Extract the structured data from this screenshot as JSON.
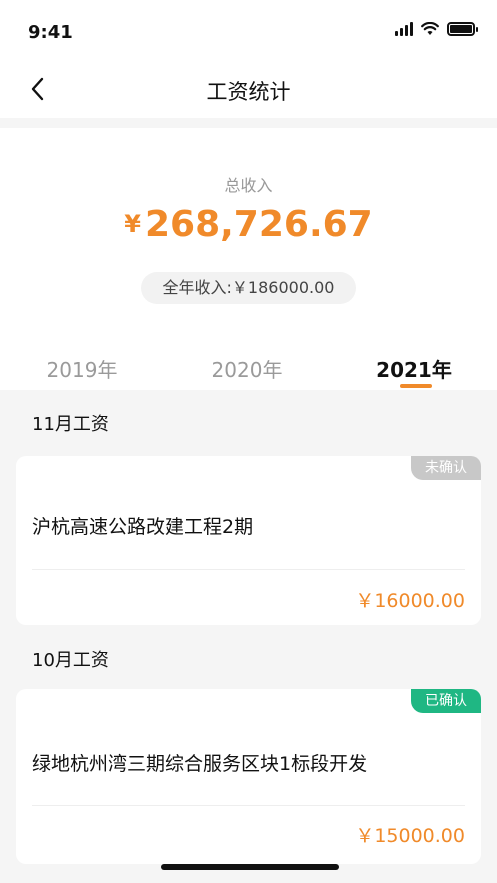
{
  "status_bar": {
    "time": "9:41"
  },
  "nav": {
    "title": "工资统计"
  },
  "summary": {
    "total_label": "总收入",
    "currency": "¥",
    "total_value": "268,726.67",
    "year_income": "全年收入:￥186000.00"
  },
  "tabs": [
    {
      "label": "2019年"
    },
    {
      "label": "2020年"
    },
    {
      "label": "2021年",
      "active": true
    }
  ],
  "months": [
    {
      "title": "11月工资",
      "status": "未确认",
      "project": "沪杭高速公路改建工程2期",
      "amount": "￥16000.00"
    },
    {
      "title": "10月工资",
      "status": "已确认",
      "project": "绿地杭州湾三期综合服务区块1标段开发",
      "amount": "￥15000.00"
    }
  ],
  "colors": {
    "accent": "#f08a2a",
    "confirmed": "#1fb783",
    "unconfirmed": "#c8c8c8"
  }
}
